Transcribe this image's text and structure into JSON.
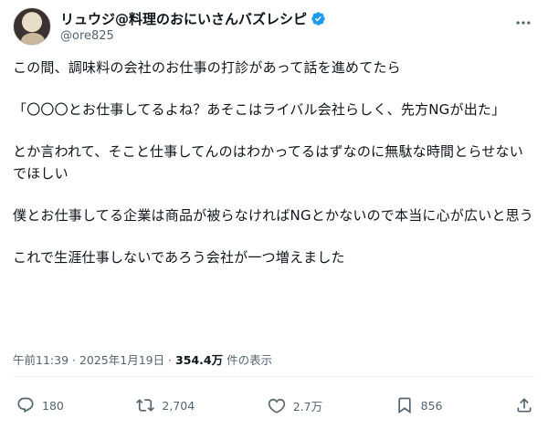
{
  "author": {
    "display_name": "リュウジ@料理のおにいさんバズレシピ",
    "handle": "@ore825"
  },
  "tweet": {
    "paragraphs": [
      "この間、調味料の会社のお仕事の打診があって話を進めてたら",
      "「〇〇〇とお仕事してるよね？あそこはライバル会社らしく、先方NGが出た」",
      "とか言われて、そこと仕事してんのはわかってるはずなのに無駄な時間とらせないでほしい",
      "僕とお仕事してる企業は商品が被らなければNGとかないので本当に心が広いと思う",
      "これで生涯仕事しないであろう会社が一つ増えました"
    ],
    "timestamp": "午前11:39 · 2025年1月19日 · ",
    "views_count": "354.4万",
    "views_label": " 件の表示"
  },
  "actions": {
    "reply_count": "180",
    "retweet_count": "2,704",
    "like_count": "2.7万",
    "bookmark_count": "856"
  },
  "colors": {
    "verified": "#1d9bf0",
    "icon_gray": "#536471",
    "text": "#0f1419"
  }
}
